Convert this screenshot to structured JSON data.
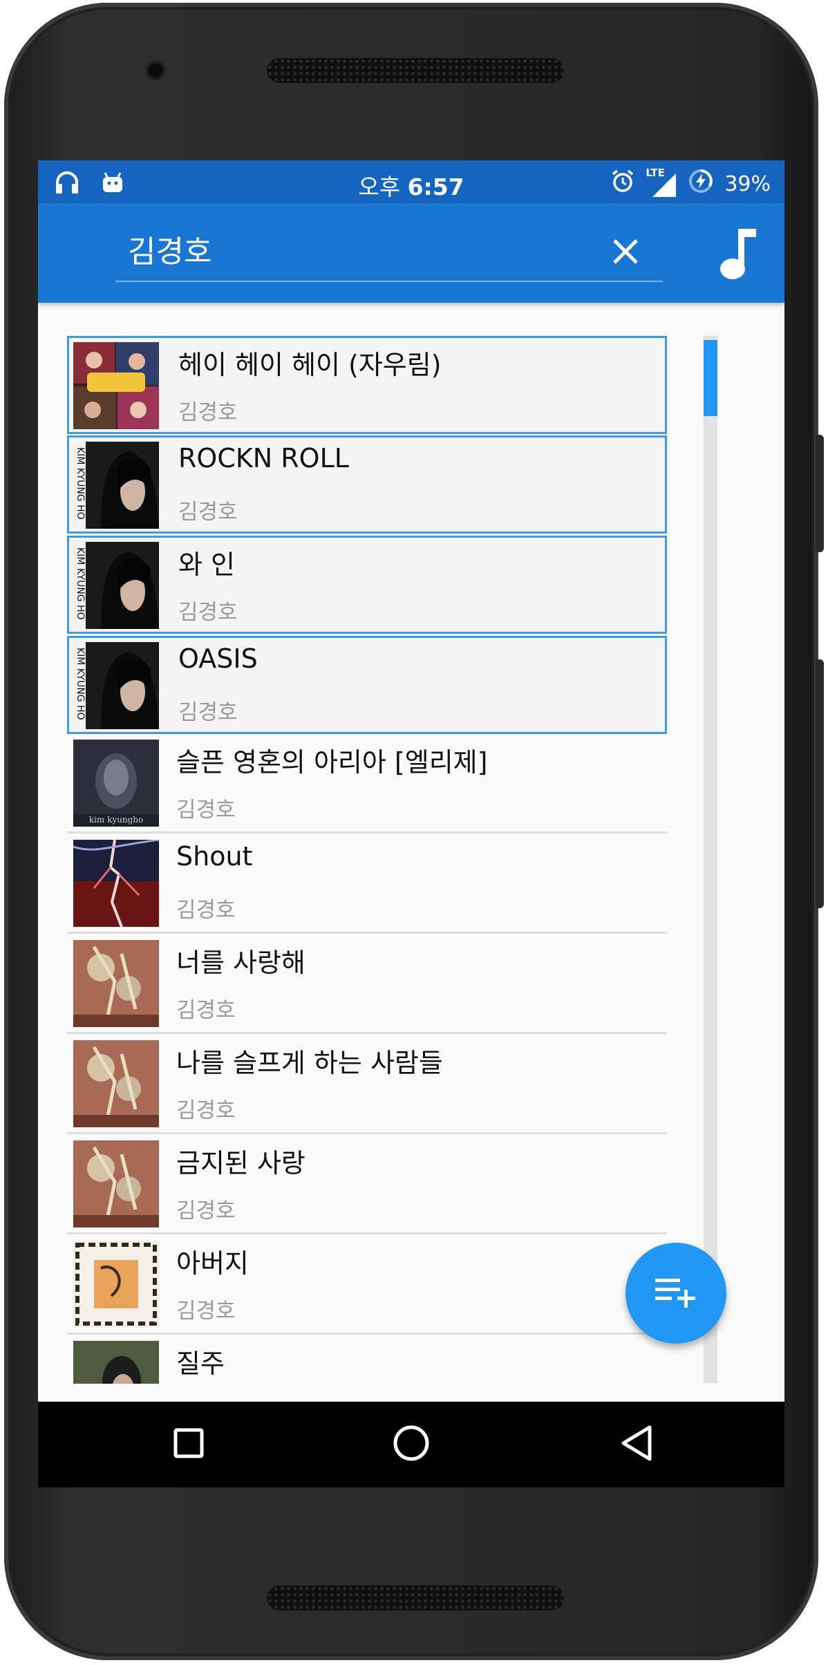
{
  "status_bar": {
    "time_prefix": "오후",
    "time": "6:57",
    "network": "LTE",
    "battery": "39%",
    "icons": [
      "headphones-icon",
      "android-debug-icon",
      "alarm-icon",
      "signal-icon",
      "battery-charging-icon"
    ]
  },
  "search": {
    "query": "김경호",
    "clear_icon": "close-icon",
    "action_icon": "music-note-icon"
  },
  "songs": [
    {
      "title": "헤이 헤이 헤이 (자우림)",
      "artist": "김경호",
      "selected": true,
      "art": "concert-collage"
    },
    {
      "title": "ROCKN ROLL",
      "artist": "김경호",
      "selected": true,
      "art": "kim-kyung-ho-portrait",
      "art_text": "KIM KYUNG HO"
    },
    {
      "title": "와 인",
      "artist": "김경호",
      "selected": true,
      "art": "kim-kyung-ho-portrait",
      "art_text": "KIM KYUNG HO"
    },
    {
      "title": "OASIS",
      "artist": "김경호",
      "selected": true,
      "art": "kim-kyung-ho-portrait",
      "art_text": "KIM KYUNG HO"
    },
    {
      "title": "슬픈 영혼의 아리아 [엘리제]",
      "artist": "김경호",
      "selected": false,
      "art": "dark-face",
      "art_text": "kim kyungho"
    },
    {
      "title": "Shout",
      "artist": "김경호",
      "selected": false,
      "art": "red-lightning"
    },
    {
      "title": "너를 사랑해",
      "artist": "김경호",
      "selected": false,
      "art": "patterned-cover"
    },
    {
      "title": "나를 슬프게 하는 사람들",
      "artist": "김경호",
      "selected": false,
      "art": "patterned-cover"
    },
    {
      "title": "금지된 사랑",
      "artist": "김경호",
      "selected": false,
      "art": "patterned-cover"
    },
    {
      "title": "아버지",
      "artist": "김경호",
      "selected": false,
      "art": "calligraphy-cover"
    },
    {
      "title": "질주",
      "artist": "김경호",
      "selected": false,
      "art": "portrait-green"
    }
  ],
  "fab": {
    "icon": "playlist-add-icon"
  },
  "nav": {
    "icons": [
      "recents-square-icon",
      "home-circle-icon",
      "back-triangle-icon"
    ]
  },
  "colors": {
    "status_bar": "#1565c0",
    "toolbar": "#1976d2",
    "accent": "#2196f3",
    "selection_border": "#3d9be0"
  }
}
